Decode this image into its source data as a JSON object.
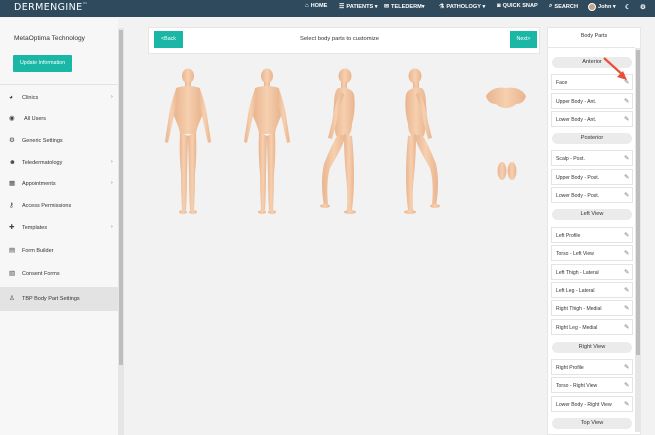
{
  "topbar": {
    "logo": "DERMENGINE",
    "logo_mark": "™",
    "nav": [
      {
        "icon": "home-icon",
        "label": "HOME"
      },
      {
        "icon": "patients-icon",
        "label": "PATIENTS ▾"
      },
      {
        "icon": "telederm-icon",
        "label": "TELEDERM▾"
      },
      {
        "icon": "pathology-icon",
        "label": "PATHOLOGY ▾"
      },
      {
        "icon": "camera-icon",
        "label": "QUICK SNAP"
      },
      {
        "icon": "search-icon",
        "label": "SEARCH"
      },
      {
        "icon": "user-icon",
        "label": "John ▾"
      }
    ]
  },
  "sidebar": {
    "org_name": "MetaOptima Technology",
    "update_button": "Update Information",
    "items": [
      {
        "label": "Clinics",
        "icon": "pie-chart-icon",
        "chevron": "›"
      },
      {
        "label": "All Users",
        "icon": "user-circle-icon",
        "chevron": ""
      },
      {
        "label": "Generic Settings",
        "icon": "gear-icon",
        "chevron": ""
      },
      {
        "label": "Teledermatology",
        "icon": "users-icon",
        "chevron": "›"
      },
      {
        "label": "Appointments",
        "icon": "calendar-icon",
        "chevron": "›"
      },
      {
        "label": "Access Permissions",
        "icon": "key-icon",
        "chevron": ""
      },
      {
        "label": "Templates",
        "icon": "puzzle-icon",
        "chevron": "›"
      },
      {
        "label": "Form Builder",
        "icon": "form-icon",
        "chevron": ""
      },
      {
        "label": "Consent Forms",
        "icon": "document-icon",
        "chevron": ""
      },
      {
        "label": "TBP Body Part Settings",
        "icon": "body-icon",
        "chevron": ""
      }
    ]
  },
  "main": {
    "back_button": "<Back",
    "next_button": "Next>",
    "title": "Select body parts to customize"
  },
  "body_parts": {
    "title": "Body Parts",
    "sections": [
      {
        "header": "Anterior",
        "parts": [
          "Face",
          "Upper Body - Ant.",
          "Lower Body - Ant."
        ]
      },
      {
        "header": "Posterior",
        "parts": [
          "Scalp - Post.",
          "Upper Body - Post.",
          "Lower Body - Post."
        ]
      },
      {
        "header": "Left View",
        "parts": [
          "Left Profile",
          "Torso - Left View",
          "Left Thigh - Lateral",
          "Left Leg - Lateral",
          "Right Thigh - Medial",
          "Right Leg - Medial"
        ]
      },
      {
        "header": "Right View",
        "parts": [
          "Right Profile",
          "Torso - Right View",
          "Lower Body - Right View"
        ]
      },
      {
        "header": "Top View",
        "parts": []
      }
    ],
    "edit_icon": "pencil-icon"
  },
  "colors": {
    "topbar": "#2e4a5c",
    "accent": "#1bb7a6",
    "skin": "#f3c7a4",
    "arrow": "#e8503a"
  }
}
